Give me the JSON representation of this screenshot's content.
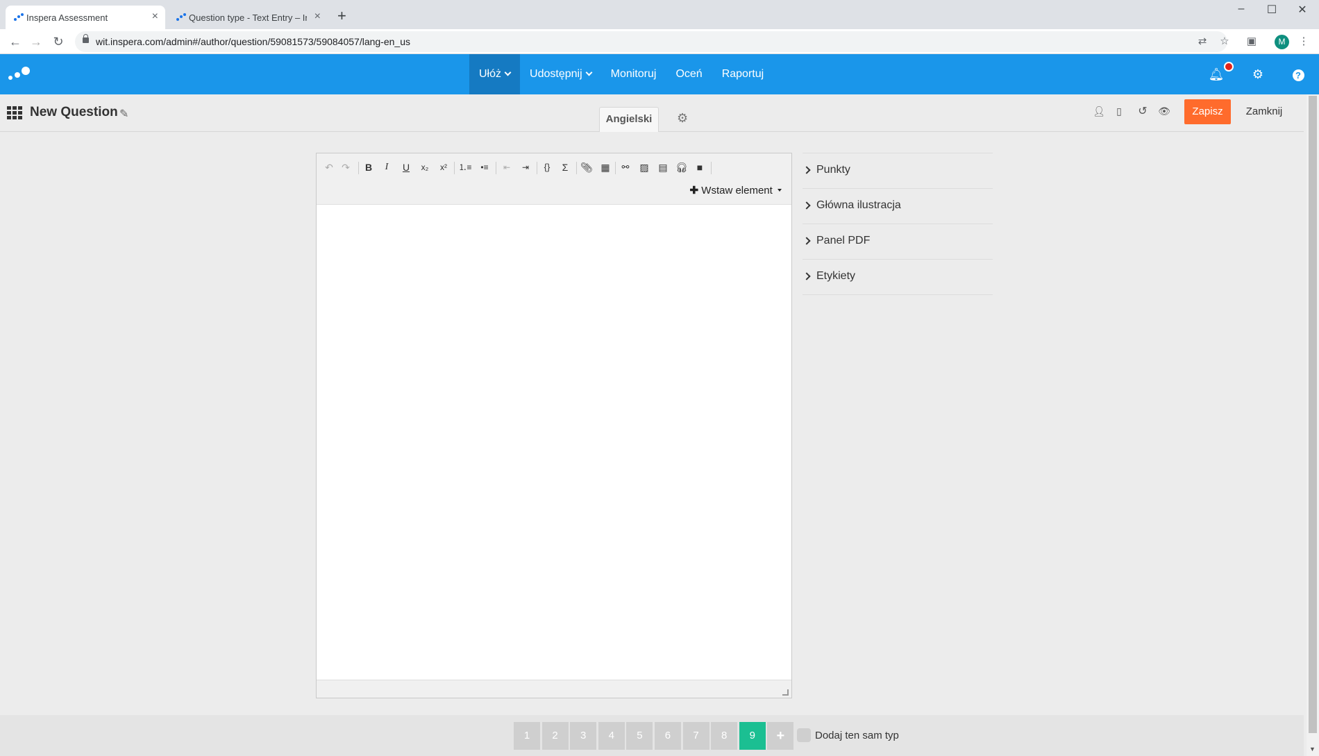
{
  "browser": {
    "tabs": [
      {
        "title": "Inspera Assessment",
        "active": true
      },
      {
        "title": "Question type - Text Entry – Insp",
        "active": false
      }
    ],
    "new_tab_glyph": "+",
    "window_controls": {
      "minimize": "–",
      "maximize": "☐",
      "close": "✕"
    },
    "url": "wit.inspera.com/admin#/author/question/59081573/59084057/lang-en_us",
    "profile_initial": "M"
  },
  "app": {
    "brand_color": "#1a96ea",
    "nav": [
      {
        "label": "Ułóż",
        "has_dropdown": true,
        "active": true
      },
      {
        "label": "Udostępnij",
        "has_dropdown": true,
        "active": false
      },
      {
        "label": "Monitoruj",
        "has_dropdown": false,
        "active": false
      },
      {
        "label": "Oceń",
        "has_dropdown": false,
        "active": false
      },
      {
        "label": "Raportuj",
        "has_dropdown": false,
        "active": false
      }
    ],
    "header_icons": [
      "bell-icon",
      "gear-icon",
      "help-icon"
    ]
  },
  "subheader": {
    "title": "New Question",
    "language_tab": "Angielski",
    "save_label": "Zapisz",
    "close_label": "Zamknij",
    "save_color": "#ff6b2c"
  },
  "editor": {
    "toolbar_buttons": [
      "undo",
      "redo",
      "bold",
      "italic",
      "underline",
      "subscript",
      "superscript",
      "ordered-list",
      "unordered-list",
      "outdent",
      "indent",
      "code",
      "sigma",
      "attach",
      "table",
      "link",
      "image",
      "pdf",
      "audio",
      "video"
    ],
    "insert_element_label": "Wstaw element"
  },
  "sidebar": {
    "items": [
      {
        "label": "Punkty"
      },
      {
        "label": "Główna ilustracja"
      },
      {
        "label": "Panel PDF"
      },
      {
        "label": "Etykiety"
      }
    ]
  },
  "pager": {
    "pages": [
      "1",
      "2",
      "3",
      "4",
      "5",
      "6",
      "7",
      "8",
      "9"
    ],
    "active_page": "9",
    "add_glyph": "+",
    "same_type_label": "Dodaj ten sam typ",
    "active_color": "#1bbf92"
  }
}
